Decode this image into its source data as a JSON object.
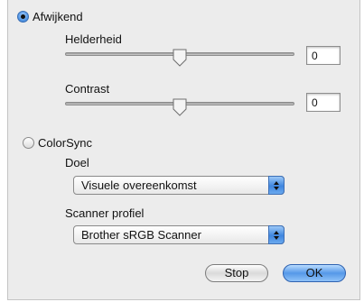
{
  "afwijkend": {
    "label": "Afwijkend",
    "selected": true
  },
  "helderheid": {
    "label": "Helderheid",
    "value": "0",
    "slider_level": 0.5
  },
  "contrast": {
    "label": "Contrast",
    "value": "0",
    "slider_level": 0.5
  },
  "colorsync": {
    "label": "ColorSync",
    "selected": false
  },
  "doel": {
    "label": "Doel",
    "selected": "Visuele overeenkomst"
  },
  "scanner_profiel": {
    "label": "Scanner profiel",
    "selected": "Brother sRGB Scanner"
  },
  "buttons": {
    "stop": "Stop",
    "ok": "OK"
  },
  "colors": {
    "accent": "#4a8fe0",
    "panel": "#ececec"
  }
}
